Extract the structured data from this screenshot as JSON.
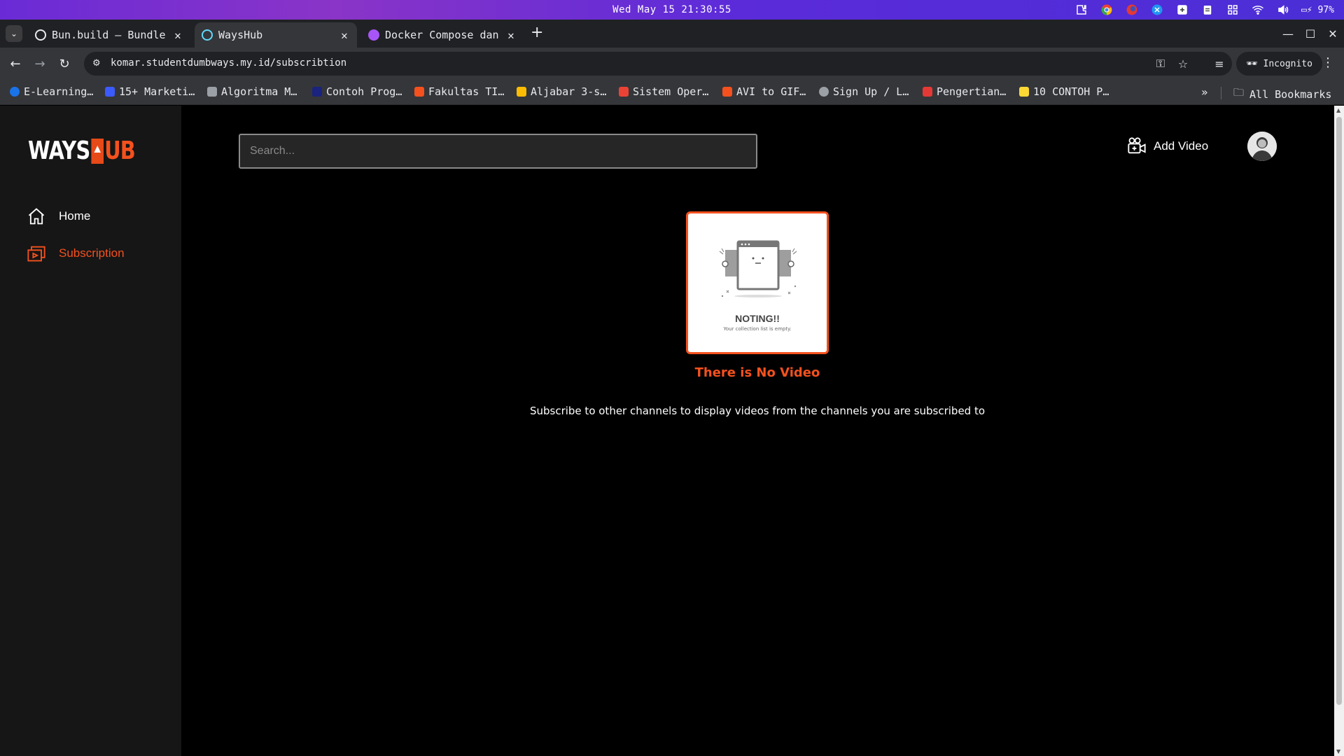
{
  "os": {
    "clock": "Wed May 15 21:30:55",
    "battery": "97%",
    "tray_icons": [
      "extension-icon",
      "chrome-icon",
      "app-icon",
      "app-icon-2",
      "screen-record-icon",
      "clipboard-icon",
      "grid-icon",
      "wifi-icon",
      "volume-icon"
    ]
  },
  "browser": {
    "tabs": [
      {
        "title": "Bun.build – Bundler",
        "favicon_color": "#e8eaed",
        "active": false
      },
      {
        "title": "WaysHub",
        "favicon_color": "#61dafb",
        "active": true
      },
      {
        "title": "Docker Compose dan",
        "favicon_color": "#a855f7",
        "active": false
      }
    ],
    "new_tab": "+",
    "url": "komar.studentdumbways.my.id/subscribtion",
    "incognito_label": "Incognito",
    "bookmarks": [
      {
        "label": "E-Learning…",
        "color": "#1a73e8"
      },
      {
        "label": "15+ Marketi…",
        "color": "#3b5bfd"
      },
      {
        "label": "Algoritma M…",
        "color": "#9aa0a6"
      },
      {
        "label": "Contoh Prog…",
        "color": "#1a237e"
      },
      {
        "label": "Fakultas TI…",
        "color": "#f4511e"
      },
      {
        "label": "Aljabar 3-s…",
        "color": "#fbbc04"
      },
      {
        "label": "Sistem Oper…",
        "color": "#ea4335"
      },
      {
        "label": "AVI to GIF…",
        "color": "#f4511e"
      },
      {
        "label": "Sign Up / L…",
        "color": "#9aa0a6"
      },
      {
        "label": "Pengertian…",
        "color": "#e53935"
      },
      {
        "label": "10 CONTOH P…",
        "color": "#fdd835"
      }
    ],
    "more_bookmarks": "»",
    "all_bookmarks": "All Bookmarks"
  },
  "app": {
    "logo": {
      "part1": "WAYS",
      "part2": "UB"
    },
    "nav": [
      {
        "label": "Home",
        "icon": "home-icon",
        "active": false
      },
      {
        "label": "Subscription",
        "icon": "subscription-icon",
        "active": true
      }
    ],
    "search_placeholder": "Search...",
    "add_video_label": "Add Video",
    "empty_state": {
      "title": "NOTING!!",
      "subtitle": "Your collection list is empty.",
      "heading": "There is No Video",
      "message": "Subscribe to other channels to display videos from the channels you are subscribed to"
    },
    "accent_color": "#f4511e"
  }
}
